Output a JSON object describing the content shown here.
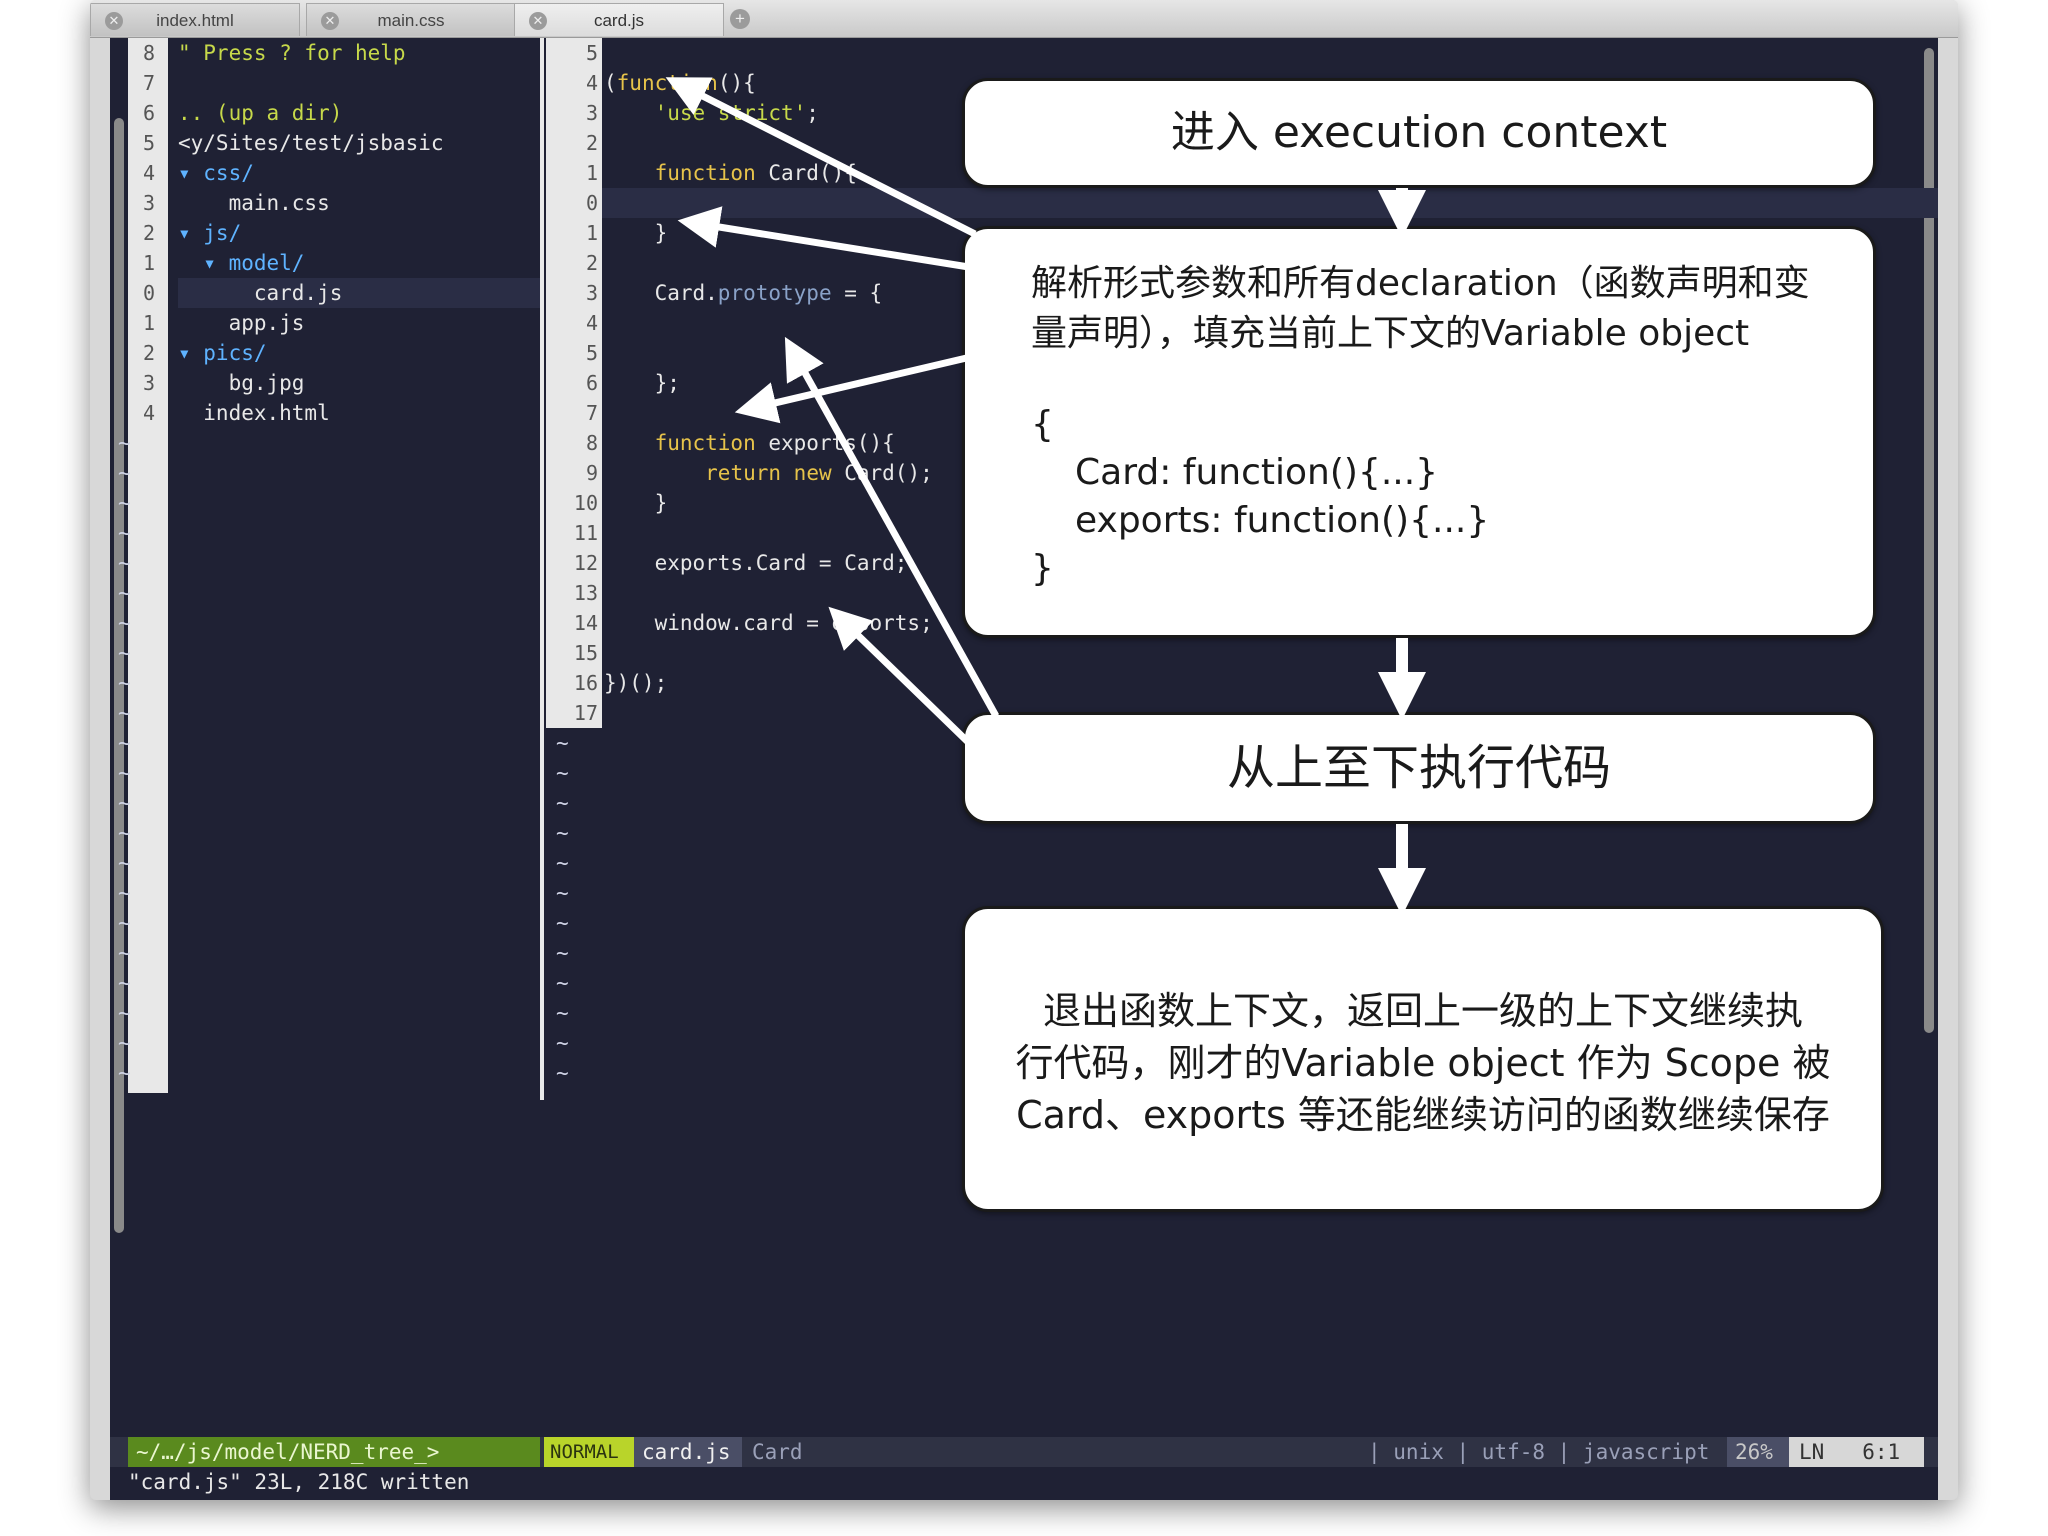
{
  "tabs": [
    {
      "label": "index.html",
      "active": false
    },
    {
      "label": "main.css",
      "active": false
    },
    {
      "label": "card.js",
      "active": true
    }
  ],
  "tab_close_glyph": "✕",
  "new_tab_glyph": "+",
  "tree": {
    "lines": [
      {
        "num": "8",
        "text": "\" Press ? for help",
        "kind": "help"
      },
      {
        "num": "7",
        "text": "",
        "kind": "plain"
      },
      {
        "num": "6",
        "text": ".. (up a dir)",
        "kind": "help"
      },
      {
        "num": "5",
        "text": "<y/Sites/test/jsbasic",
        "kind": "plain"
      },
      {
        "num": "4",
        "text": "▾ css/",
        "kind": "dir"
      },
      {
        "num": "3",
        "text": "    main.css",
        "kind": "plain"
      },
      {
        "num": "2",
        "text": "▾ js/",
        "kind": "dir"
      },
      {
        "num": "1",
        "text": "  ▾ model/",
        "kind": "dir"
      },
      {
        "num": "0",
        "text": "      card.js",
        "kind": "plain"
      },
      {
        "num": "1",
        "text": "    app.js",
        "kind": "plain"
      },
      {
        "num": "2",
        "text": "▾ pics/",
        "kind": "dir"
      },
      {
        "num": "3",
        "text": "    bg.jpg",
        "kind": "plain"
      },
      {
        "num": "4",
        "text": "  index.html",
        "kind": "plain"
      }
    ]
  },
  "code": {
    "lines": [
      {
        "num": "5",
        "text": ""
      },
      {
        "num": "4",
        "text": "(function(){"
      },
      {
        "num": "3",
        "text": "    'use strict';"
      },
      {
        "num": "2",
        "text": ""
      },
      {
        "num": "1",
        "text": "    function Card(){"
      },
      {
        "num": "0",
        "text": ""
      },
      {
        "num": "1",
        "text": "    }"
      },
      {
        "num": "2",
        "text": ""
      },
      {
        "num": "3",
        "text": "    Card.prototype = {"
      },
      {
        "num": "4",
        "text": ""
      },
      {
        "num": "5",
        "text": ""
      },
      {
        "num": "6",
        "text": "    };"
      },
      {
        "num": "7",
        "text": ""
      },
      {
        "num": "8",
        "text": "    function exports(){"
      },
      {
        "num": "9",
        "text": "        return new Card();"
      },
      {
        "num": "10",
        "text": "    }"
      },
      {
        "num": "11",
        "text": ""
      },
      {
        "num": "12",
        "text": "    exports.Card = Card;"
      },
      {
        "num": "13",
        "text": ""
      },
      {
        "num": "14",
        "text": "    window.card = exports;"
      },
      {
        "num": "15",
        "text": ""
      },
      {
        "num": "16",
        "text": "})();"
      },
      {
        "num": "17",
        "text": ""
      }
    ]
  },
  "tilde": "~",
  "status": {
    "tree_path": "~/…/js/model/NERD_tree_>",
    "mode": "NORMAL",
    "file": "card.js",
    "func": "Card",
    "right": "| unix | utf-8 | javascript",
    "percent": "26%",
    "ln_label": "LN",
    "position": "6:1"
  },
  "cmdline": "\"card.js\" 23L, 218C written",
  "boxes": {
    "enter": "进入 execution context",
    "parse_line1": "解析形式参数和所有declaration（函数声明和变",
    "parse_line2": "量声明），填充当前上下文的Variable object",
    "parse_obj_open": "{",
    "parse_obj_card": "Card: function(){...}",
    "parse_obj_exports": "exports: function(){...}",
    "parse_obj_close": "}",
    "execute": "从上至下执行代码",
    "exit_line1": "退出函数上下文，返回上一级的上下文继续执",
    "exit_line2": "行代码，刚才的Variable object 作为 Scope 被",
    "exit_line3": "Card、exports 等还能继续访问的函数继续保存"
  }
}
